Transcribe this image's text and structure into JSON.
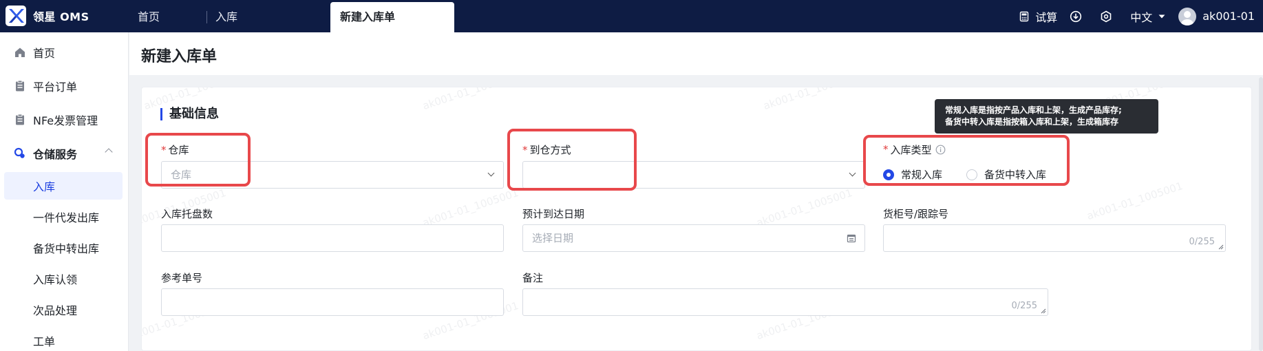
{
  "app": {
    "logo_text": "领星 OMS"
  },
  "tabs": [
    {
      "label": "首页"
    },
    {
      "label": "入库"
    },
    {
      "label": "新建入库单"
    }
  ],
  "top_right": {
    "trial": "试算",
    "language": "中文",
    "username": "ak001-01"
  },
  "sidebar": {
    "items": [
      {
        "label": "首页",
        "icon": "home-icon"
      },
      {
        "label": "平台订单",
        "icon": "clipboard-icon"
      },
      {
        "label": "NFe发票管理",
        "icon": "clipboard-icon"
      },
      {
        "label": "仓储服务",
        "icon": "warehouse-service-icon"
      }
    ],
    "sub_items": [
      {
        "label": "入库",
        "active": true
      },
      {
        "label": "一件代发出库"
      },
      {
        "label": "备货中转出库"
      },
      {
        "label": "入库认领"
      },
      {
        "label": "次品处理"
      },
      {
        "label": "工单"
      }
    ]
  },
  "page": {
    "title": "新建入库单"
  },
  "form": {
    "section_title": "基础信息",
    "warehouse": {
      "label": "仓库",
      "placeholder": "仓库"
    },
    "arrival_method": {
      "label": "到仓方式",
      "placeholder": ""
    },
    "inbound_type": {
      "label": "入库类型",
      "options": [
        "常规入库",
        "备货中转入库"
      ],
      "selected": "常规入库"
    },
    "pallet_count": {
      "label": "入库托盘数",
      "value": ""
    },
    "expected_date": {
      "label": "预计到达日期",
      "placeholder": "选择日期"
    },
    "container_no": {
      "label": "货柜号/跟踪号",
      "count": "0/255"
    },
    "reference_no": {
      "label": "参考单号",
      "value": ""
    },
    "remark": {
      "label": "备注",
      "count": "0/255"
    }
  },
  "tooltip": {
    "line1": "常规入库是指按产品入库和上架，生成产品库存;",
    "line2": "备货中转入库是指按箱入库和上架，生成箱库存"
  },
  "watermark_text": "ak001-01_1005001",
  "colors": {
    "topbar": "#0e1c44",
    "primary": "#2348e6",
    "required": "#e03b3b",
    "highlight": "#e8484b"
  }
}
